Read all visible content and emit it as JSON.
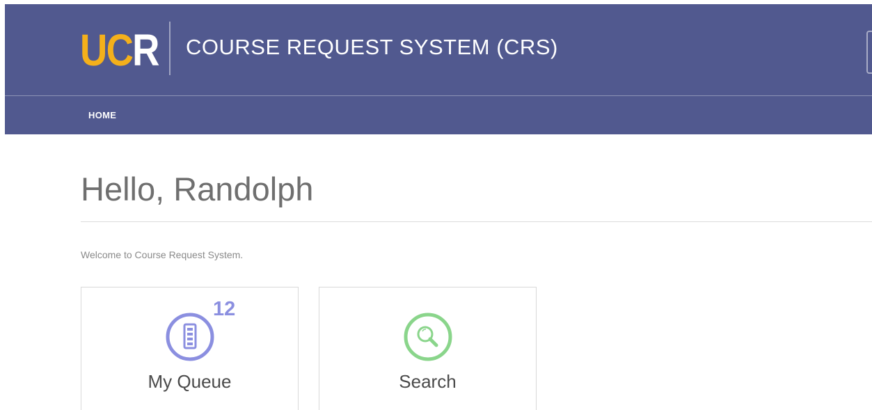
{
  "header": {
    "logo": {
      "letters": [
        "U",
        "C",
        "R"
      ],
      "brand_gold": "#f4b01b"
    },
    "title": "COURSE REQUEST SYSTEM (CRS)",
    "background": "#51598f"
  },
  "nav": {
    "items": [
      {
        "label": "HOME"
      }
    ]
  },
  "main": {
    "greeting": "Hello, Randolph",
    "welcome": "Welcome to Course Request System.",
    "tiles": [
      {
        "label": "My Queue",
        "badge": "12",
        "icon": "queue-list-icon",
        "color": "#8b8fe0"
      },
      {
        "label": "Search",
        "icon": "search-icon",
        "color": "#8ad58b"
      }
    ]
  }
}
